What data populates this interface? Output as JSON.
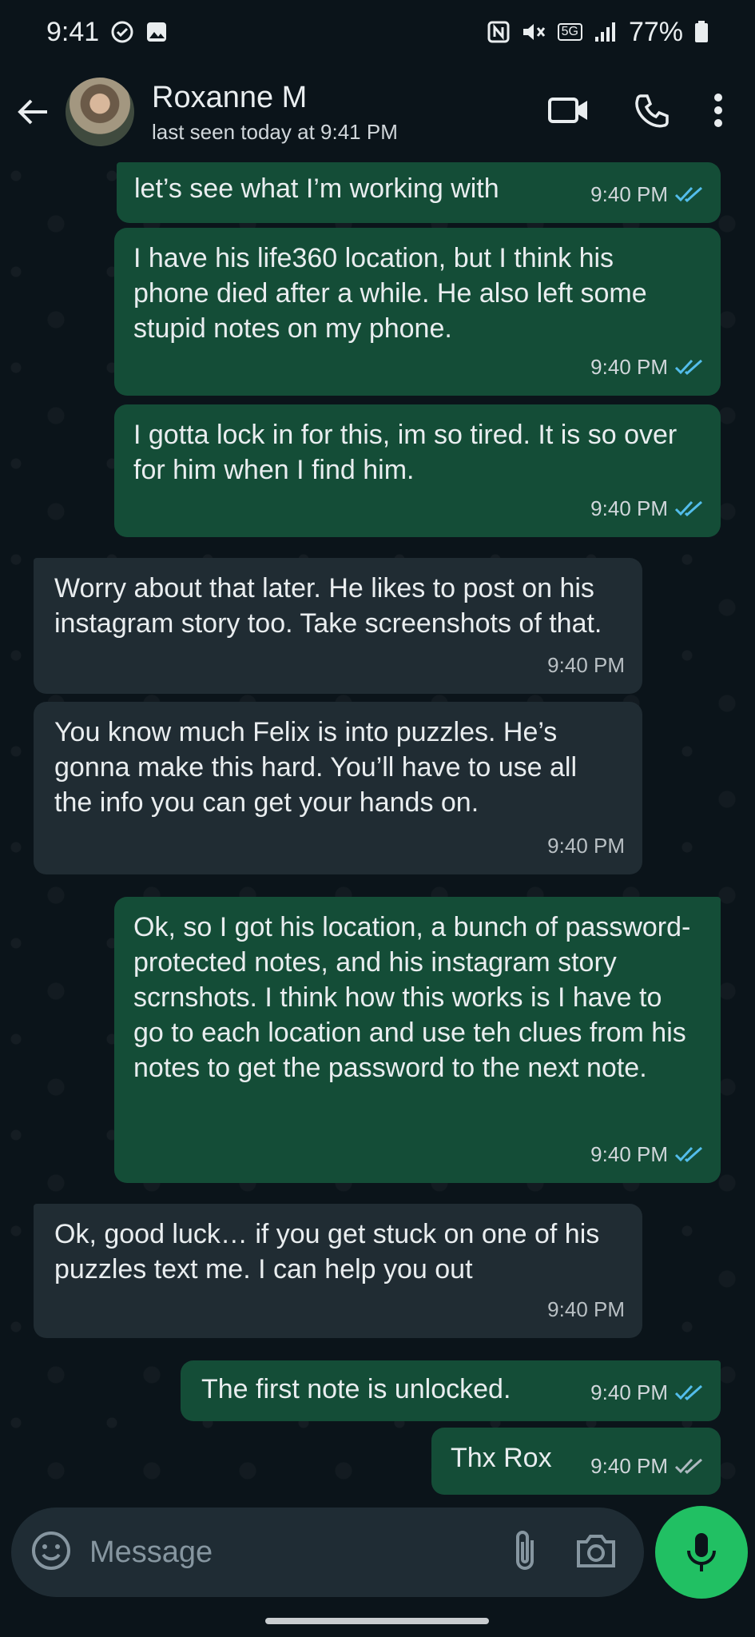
{
  "status_bar": {
    "time": "9:41",
    "network": "5G",
    "battery": "77%"
  },
  "header": {
    "contact_name": "Roxanne M",
    "last_seen": "last seen today at 9:41 PM",
    "icons": [
      "back-arrow-icon",
      "video-call-icon",
      "voice-call-icon",
      "more-vert-icon"
    ]
  },
  "messages": [
    {
      "dir": "out",
      "text": "let’s see what I’m working with",
      "time": "9:40 PM",
      "ticks": "read"
    },
    {
      "dir": "out",
      "text": "I have his life360 location, but I think his phone died after a while. He also left some stupid notes on my phone.",
      "time": "9:40 PM",
      "ticks": "read"
    },
    {
      "dir": "out",
      "text": "I gotta lock in for this, im so tired. It is so over for him when I find him.",
      "time": "9:40 PM",
      "ticks": "read"
    },
    {
      "dir": "in",
      "text": "Worry about that later. He likes to post on his instagram story too. Take screenshots of that.",
      "time": "9:40 PM"
    },
    {
      "dir": "in",
      "text": "You know much Felix is into puzzles. He’s gonna make this hard. You’ll have to use all the info you can get your hands on.",
      "time": "9:40 PM"
    },
    {
      "dir": "out",
      "text": "Ok, so I got his location, a bunch of password-protected notes, and his instagram story scrnshots. I think how this works is I have to go to each location and use teh clues from his notes to get the password to the next note.",
      "time": "9:40 PM",
      "ticks": "read"
    },
    {
      "dir": "in",
      "text": "Ok, good luck… if you get stuck on one of his puzzles text me. I can help you out",
      "time": "9:40 PM"
    },
    {
      "dir": "out",
      "text": "The first note is unlocked.",
      "time": "9:40 PM",
      "ticks": "read"
    },
    {
      "dir": "out",
      "text": "Thx Rox",
      "time": "9:40 PM",
      "ticks": "delivered"
    }
  ],
  "composer": {
    "placeholder": "Message",
    "icons": [
      "emoji-icon",
      "attach-icon",
      "camera-icon",
      "mic-icon"
    ]
  },
  "colors": {
    "background": "#0b141a",
    "outgoing_bubble": "#144d37",
    "incoming_bubble": "#202c33",
    "read_ticks": "#53bdeb",
    "accent": "#21c063"
  }
}
